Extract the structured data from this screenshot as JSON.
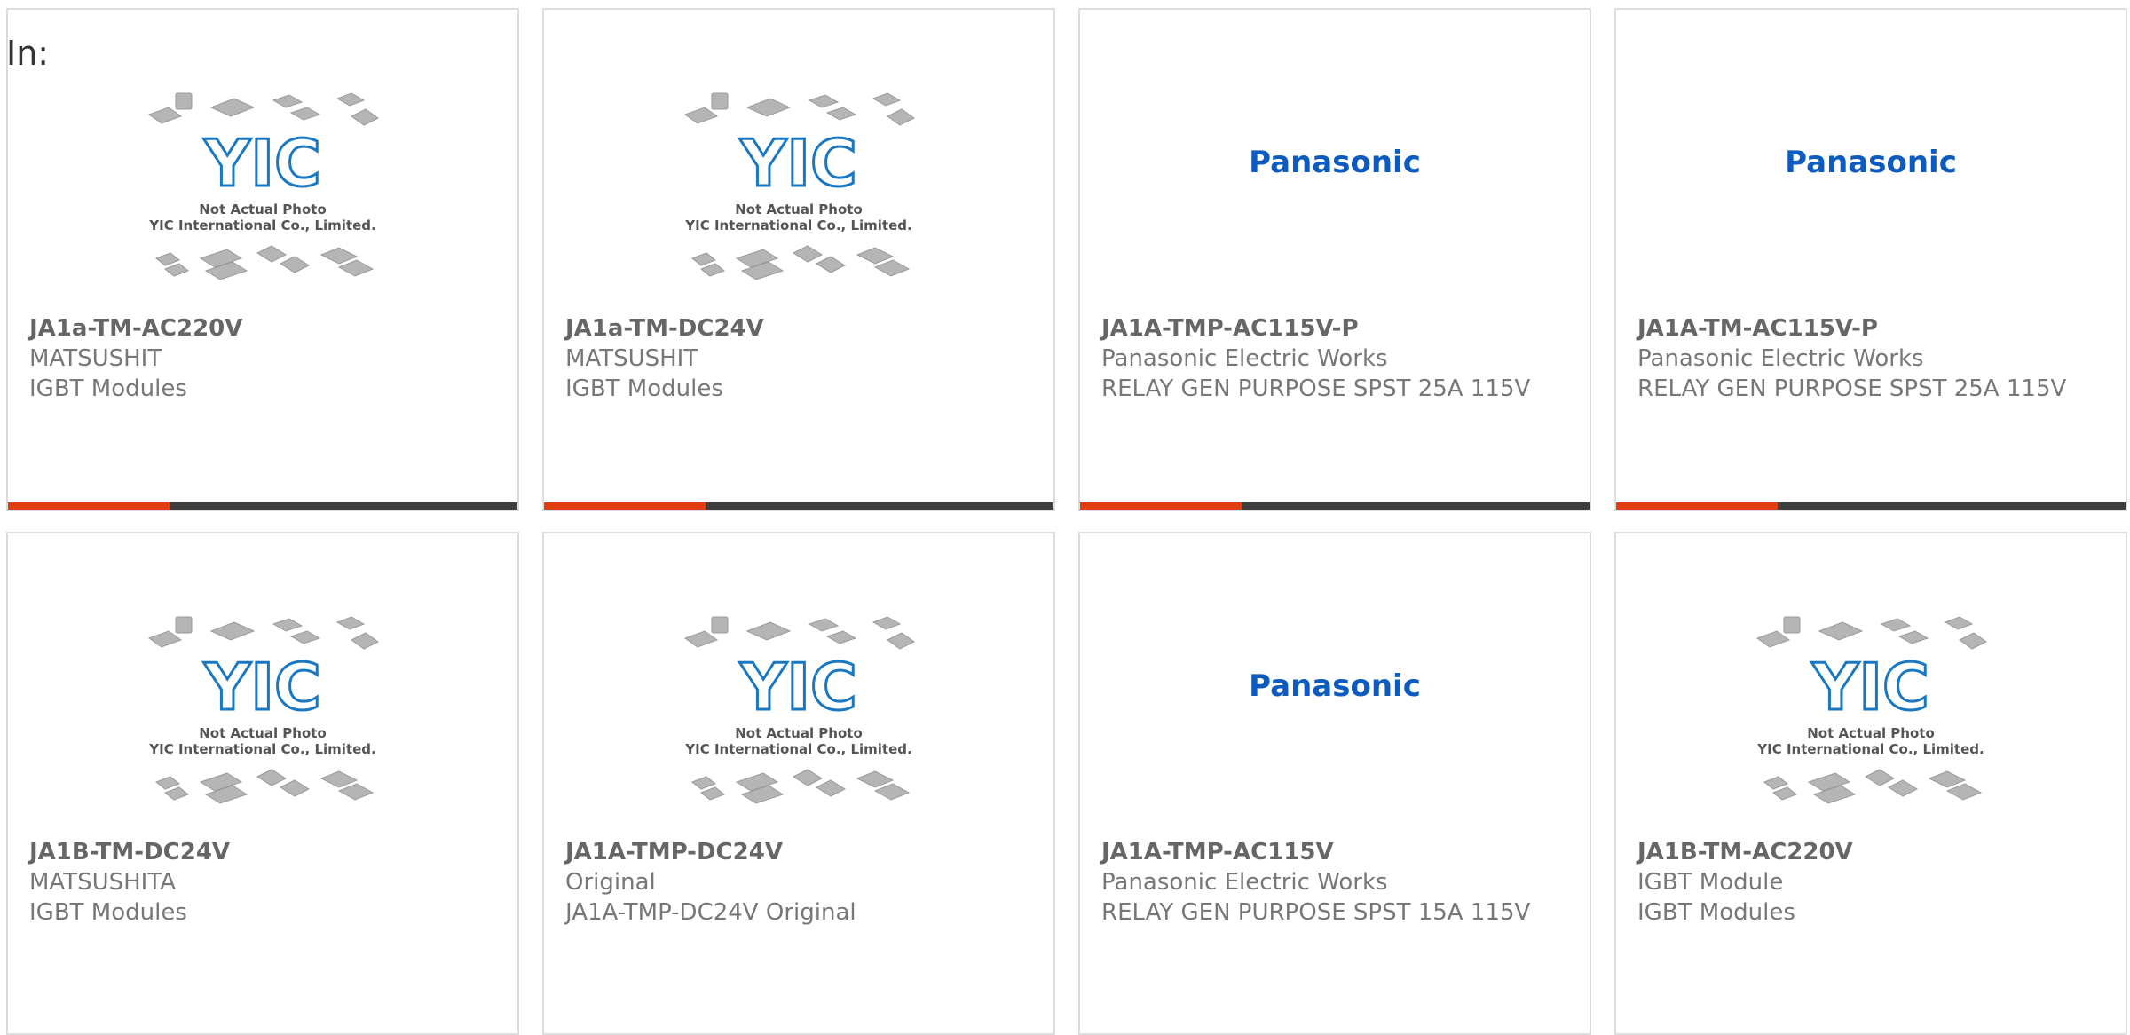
{
  "page": {
    "in_label": "In:"
  },
  "colors": {
    "accent_red": "#e03e10",
    "bar_dark": "#3d3d3d",
    "panasonic_blue": "#0d5bbf",
    "yic_blue": "#1a78c2"
  },
  "placeholder_image": {
    "brand_text": "YIC",
    "caption_line1": "Not Actual Photo",
    "caption_line2": "YIC International Co., Limited."
  },
  "panasonic_image": {
    "logo_text": "Panasonic"
  },
  "products": [
    {
      "image": "yic-placeholder",
      "part_no": "JA1a-TM-AC220V",
      "manufacturer": "MATSUSHIT",
      "description": "IGBT Modules"
    },
    {
      "image": "yic-placeholder",
      "part_no": "JA1a-TM-DC24V",
      "manufacturer": "MATSUSHIT",
      "description": "IGBT Modules"
    },
    {
      "image": "panasonic-logo",
      "part_no": "JA1A-TMP-AC115V-P",
      "manufacturer": "Panasonic Electric Works",
      "description": "RELAY GEN PURPOSE SPST 25A 115V"
    },
    {
      "image": "panasonic-logo",
      "part_no": "JA1A-TM-AC115V-P",
      "manufacturer": "Panasonic Electric Works",
      "description": "RELAY GEN PURPOSE SPST 25A 115V"
    },
    {
      "image": "yic-placeholder",
      "part_no": "JA1B-TM-DC24V",
      "manufacturer": "MATSUSHITA",
      "description": "IGBT Modules"
    },
    {
      "image": "yic-placeholder",
      "part_no": "JA1A-TMP-DC24V",
      "manufacturer": "Original",
      "description": "JA1A-TMP-DC24V Original"
    },
    {
      "image": "panasonic-logo",
      "part_no": "JA1A-TMP-AC115V",
      "manufacturer": "Panasonic Electric Works",
      "description": "RELAY GEN PURPOSE SPST 15A 115V"
    },
    {
      "image": "yic-placeholder",
      "part_no": "JA1B-TM-AC220V",
      "manufacturer": "IGBT Module",
      "description": "IGBT Modules"
    }
  ]
}
